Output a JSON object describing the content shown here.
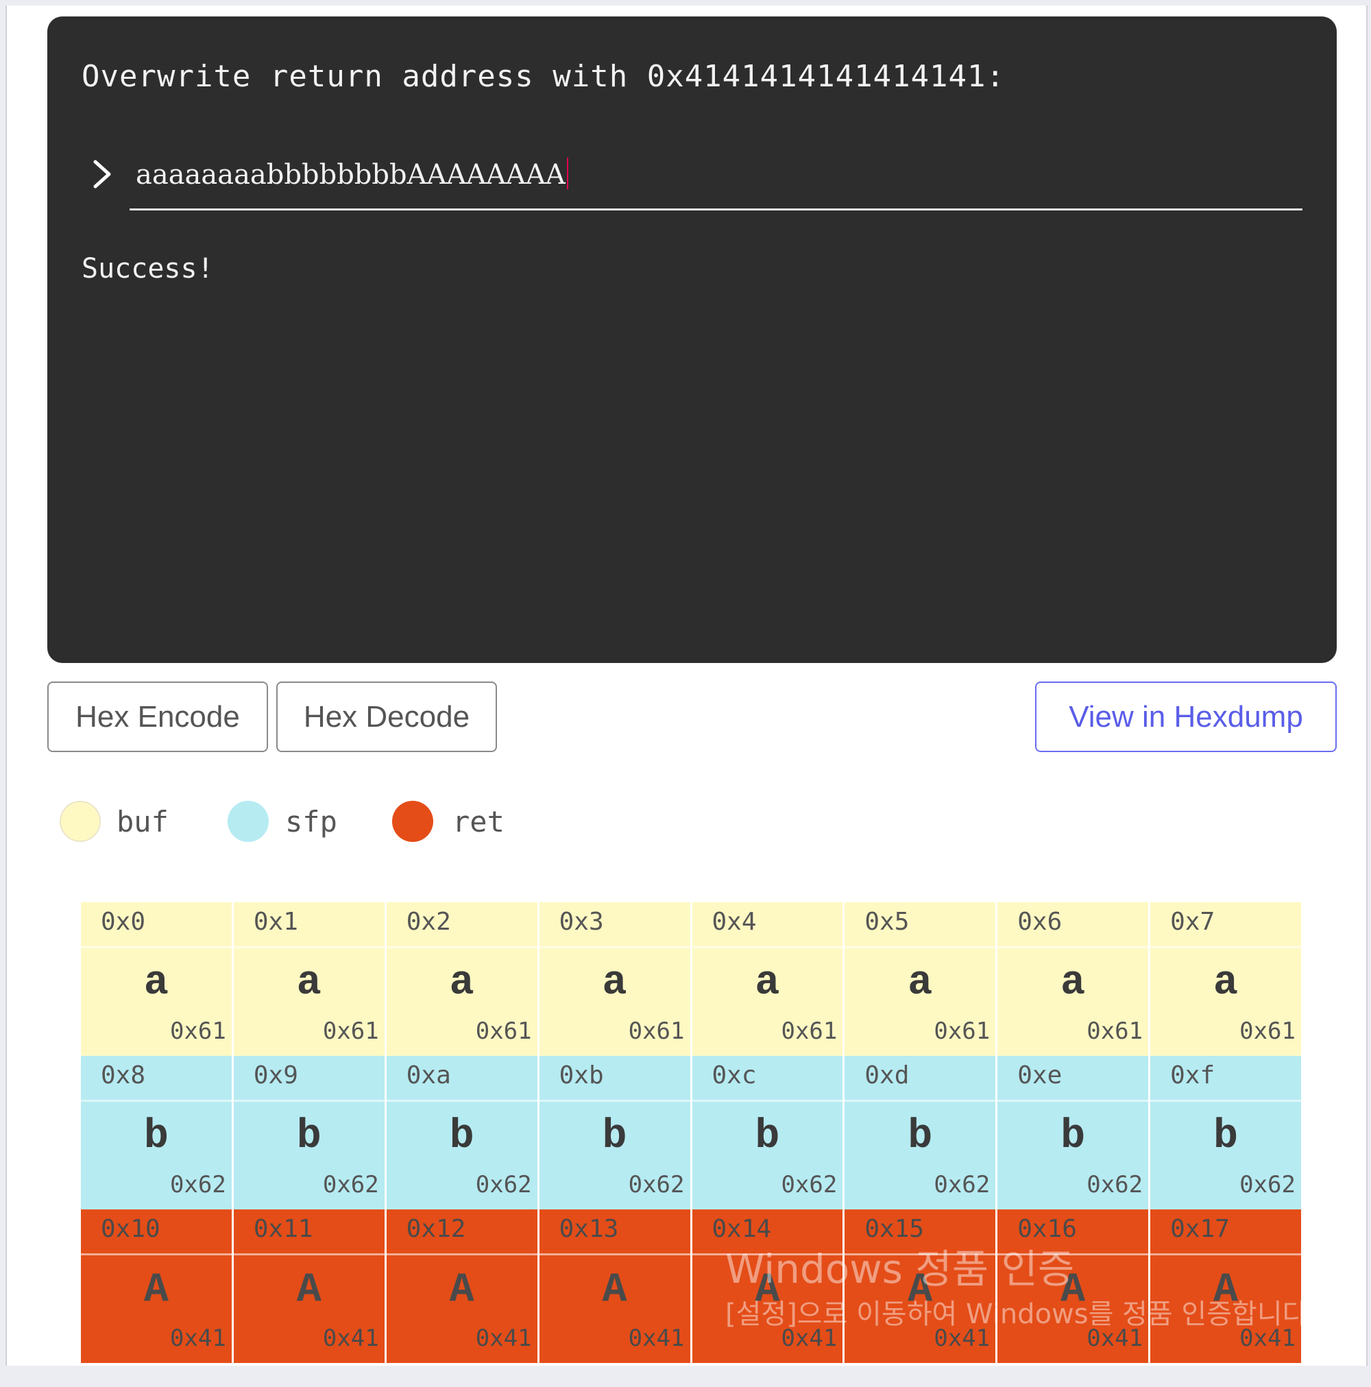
{
  "terminal": {
    "prompt": "Overwrite return address with 0x4141414141414141:",
    "input_value": "aaaaaaaabbbbbbbbAAAAAAAA",
    "result": "Success!"
  },
  "buttons": {
    "hex_encode": "Hex Encode",
    "hex_decode": "Hex Decode",
    "view_hexdump": "View in Hexdump"
  },
  "legend": [
    {
      "label": "buf",
      "color": "#fef9c3"
    },
    {
      "label": "sfp",
      "color": "#b6ebf2"
    },
    {
      "label": "ret",
      "color": "#e44d18"
    }
  ],
  "memory": [
    {
      "offset": "0x0",
      "char": "a",
      "hex": "0x61",
      "region": "buf"
    },
    {
      "offset": "0x1",
      "char": "a",
      "hex": "0x61",
      "region": "buf"
    },
    {
      "offset": "0x2",
      "char": "a",
      "hex": "0x61",
      "region": "buf"
    },
    {
      "offset": "0x3",
      "char": "a",
      "hex": "0x61",
      "region": "buf"
    },
    {
      "offset": "0x4",
      "char": "a",
      "hex": "0x61",
      "region": "buf"
    },
    {
      "offset": "0x5",
      "char": "a",
      "hex": "0x61",
      "region": "buf"
    },
    {
      "offset": "0x6",
      "char": "a",
      "hex": "0x61",
      "region": "buf"
    },
    {
      "offset": "0x7",
      "char": "a",
      "hex": "0x61",
      "region": "buf"
    },
    {
      "offset": "0x8",
      "char": "b",
      "hex": "0x62",
      "region": "sfp"
    },
    {
      "offset": "0x9",
      "char": "b",
      "hex": "0x62",
      "region": "sfp"
    },
    {
      "offset": "0xa",
      "char": "b",
      "hex": "0x62",
      "region": "sfp"
    },
    {
      "offset": "0xb",
      "char": "b",
      "hex": "0x62",
      "region": "sfp"
    },
    {
      "offset": "0xc",
      "char": "b",
      "hex": "0x62",
      "region": "sfp"
    },
    {
      "offset": "0xd",
      "char": "b",
      "hex": "0x62",
      "region": "sfp"
    },
    {
      "offset": "0xe",
      "char": "b",
      "hex": "0x62",
      "region": "sfp"
    },
    {
      "offset": "0xf",
      "char": "b",
      "hex": "0x62",
      "region": "sfp"
    },
    {
      "offset": "0x10",
      "char": "A",
      "hex": "0x41",
      "region": "ret"
    },
    {
      "offset": "0x11",
      "char": "A",
      "hex": "0x41",
      "region": "ret"
    },
    {
      "offset": "0x12",
      "char": "A",
      "hex": "0x41",
      "region": "ret"
    },
    {
      "offset": "0x13",
      "char": "A",
      "hex": "0x41",
      "region": "ret"
    },
    {
      "offset": "0x14",
      "char": "A",
      "hex": "0x41",
      "region": "ret"
    },
    {
      "offset": "0x15",
      "char": "A",
      "hex": "0x41",
      "region": "ret"
    },
    {
      "offset": "0x16",
      "char": "A",
      "hex": "0x41",
      "region": "ret"
    },
    {
      "offset": "0x17",
      "char": "A",
      "hex": "0x41",
      "region": "ret"
    }
  ],
  "watermark": {
    "title": "Windows 정품 인증",
    "subtitle": "[설정]으로 이동하여 Windows를 정품 인증합니다."
  }
}
